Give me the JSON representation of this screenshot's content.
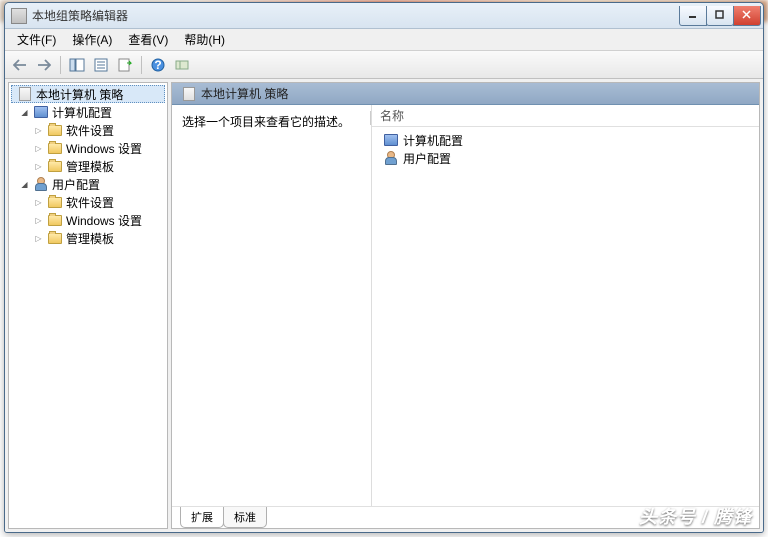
{
  "window": {
    "title": "本地组策略编辑器"
  },
  "menu": {
    "file": "文件(F)",
    "action": "操作(A)",
    "view": "查看(V)",
    "help": "帮助(H)"
  },
  "tree": {
    "root": "本地计算机 策略",
    "comp": "计算机配置",
    "user": "用户配置",
    "soft": "软件设置",
    "win": "Windows 设置",
    "tmpl": "管理模板"
  },
  "content": {
    "header": "本地计算机 策略",
    "description": "选择一个项目来查看它的描述。",
    "name_col": "名称",
    "items": {
      "comp": "计算机配置",
      "user": "用户配置"
    }
  },
  "tabs": {
    "ext": "扩展",
    "std": "标准"
  },
  "watermark": "头条号 / 腾锋"
}
